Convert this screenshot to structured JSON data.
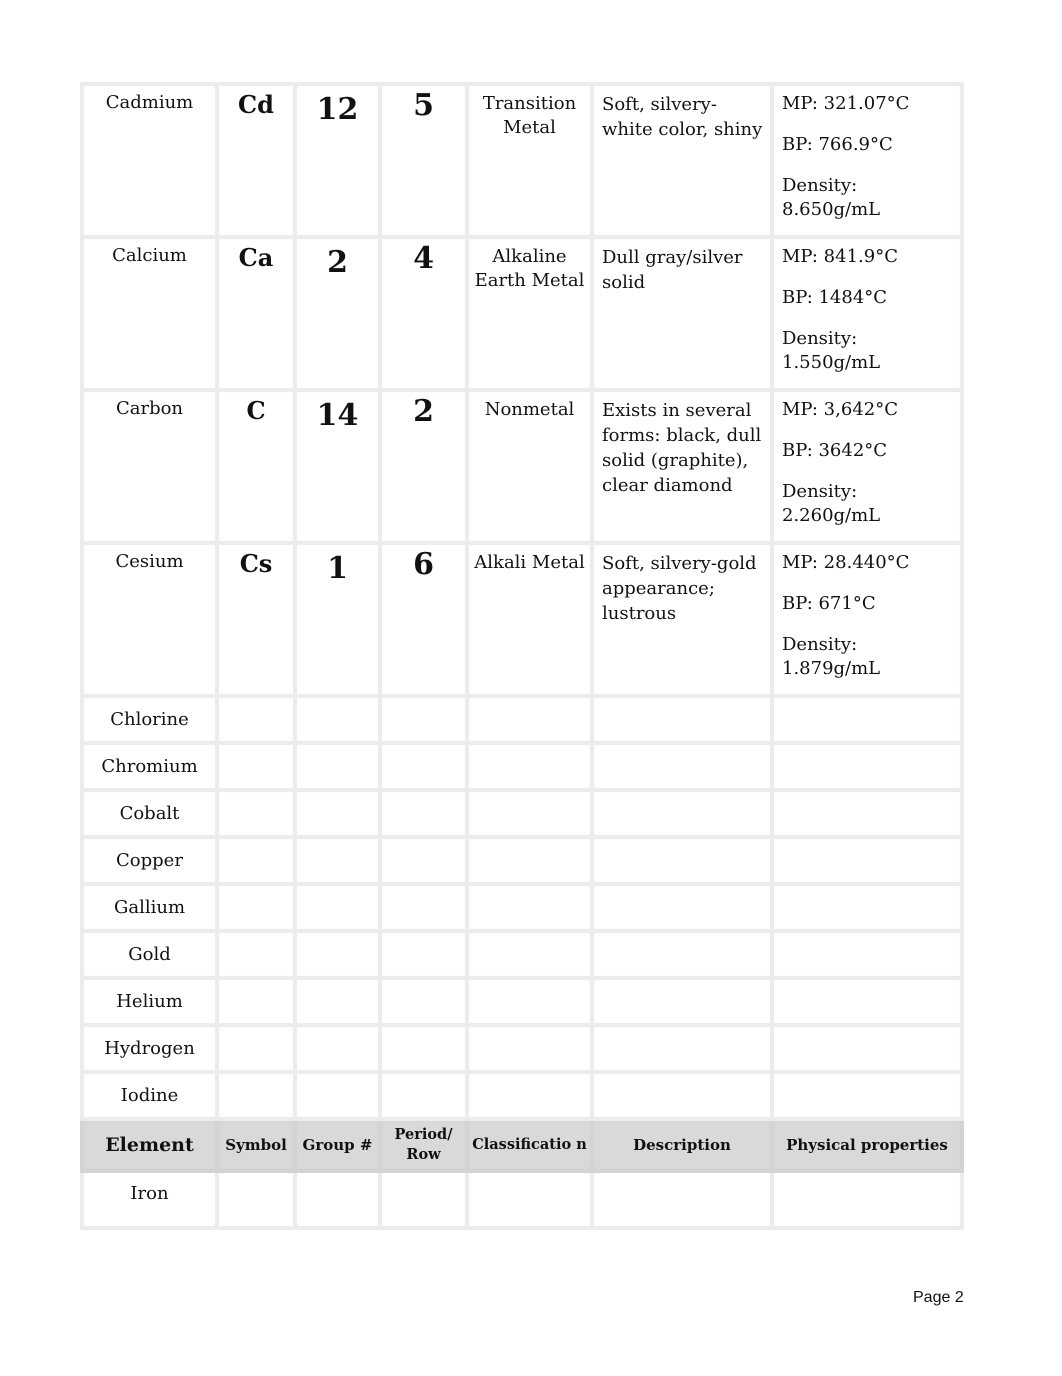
{
  "table": {
    "headers": {
      "element": "Element",
      "symbol": "Symbol",
      "group": "Group #",
      "period": "Period/ Row",
      "classification": "Classificatio n",
      "description": "Description",
      "physical": "Physical properties"
    },
    "filled_rows": [
      {
        "element": "Cadmium",
        "symbol": "Cd",
        "group": "12",
        "period": "5",
        "classification": "Transition Metal",
        "description": "Soft, silvery-white color, shiny",
        "mp": "MP: 321.07°C",
        "bp": "BP: 766.9°C",
        "density": "Density: 8.650g/mL"
      },
      {
        "element": "Calcium",
        "symbol": "Ca",
        "group": "2",
        "period": "4",
        "classification": "Alkaline Earth Metal",
        "description": "Dull gray/silver solid",
        "mp": "MP: 841.9°C",
        "bp": "BP: 1484°C",
        "density": "Density: 1.550g/mL"
      },
      {
        "element": "Carbon",
        "symbol": "C",
        "group": "14",
        "period": "2",
        "classification": "Nonmetal",
        "description": "Exists in several forms: black, dull solid (graphite), clear diamond",
        "mp": "MP: 3,642°C",
        "bp": "BP: 3642°C",
        "density": "Density: 2.260g/mL"
      },
      {
        "element": "Cesium",
        "symbol": "Cs",
        "group": "1",
        "period": "6",
        "classification": "Alkali Metal",
        "description": "Soft, silvery-gold appearance; lustrous",
        "mp": "MP: 28.440°C",
        "bp": "BP: 671°C",
        "density": "Density: 1.879g/mL"
      }
    ],
    "empty_rows": [
      "Chlorine",
      "Chromium",
      "Cobalt",
      "Copper",
      "Gallium",
      "Gold",
      "Helium",
      "Hydrogen",
      "Iodine"
    ],
    "after_header_rows": [
      "Iron"
    ]
  },
  "footer": {
    "page_label": "Page 2"
  }
}
